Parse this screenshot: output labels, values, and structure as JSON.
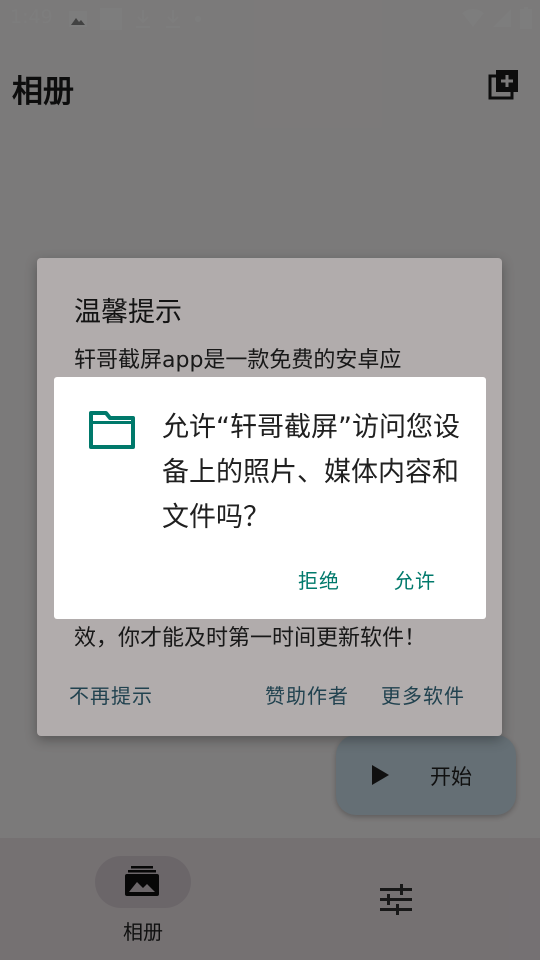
{
  "status_bar": {
    "time": "1:49"
  },
  "top_bar": {
    "title": "相册"
  },
  "bottom_nav": {
    "album_label": "相册"
  },
  "fab": {
    "label": "开始"
  },
  "tip_dialog": {
    "title": "温馨提示",
    "body_line_first": "轩哥截屏app是一款免费的安卓应",
    "body_line_last": "效，你才能及时第一时间更新软件！",
    "button_no_more": "不再提示",
    "button_sponsor": "赞助作者",
    "button_more_apps": "更多软件"
  },
  "permission_dialog": {
    "message": "允许“轩哥截屏”访问您设备上的照片、媒体内容和文件吗？",
    "deny_label": "拒绝",
    "allow_label": "允许"
  },
  "colors": {
    "accent": "#00796b",
    "folder": "#00796b"
  }
}
